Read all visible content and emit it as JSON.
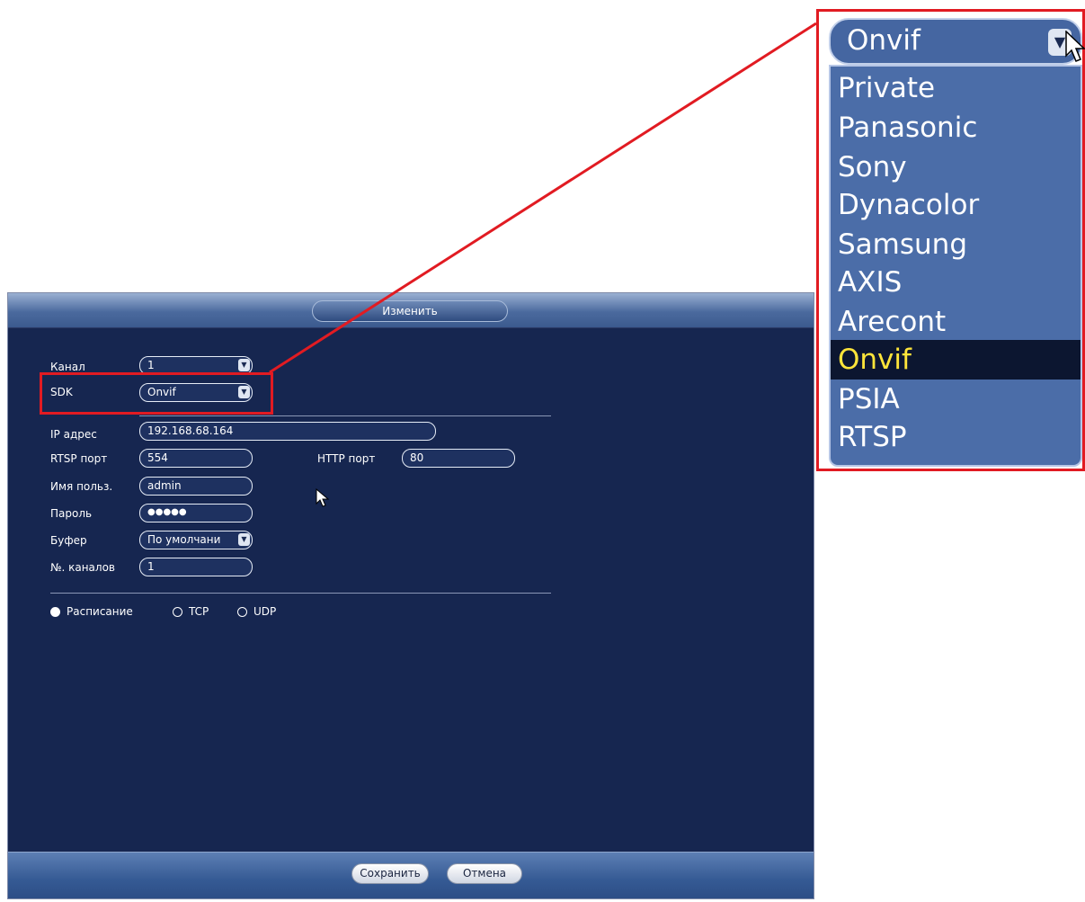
{
  "dialog": {
    "title": "Изменить",
    "channel_label": "Канал",
    "channel_value": "1",
    "sdk_label": "SDK",
    "sdk_value": "Onvif",
    "ip_label": "IP адрес",
    "ip_value": "192.168.68.164",
    "rtsp_label": "RTSP порт",
    "rtsp_value": "554",
    "http_label": "HTTP порт",
    "http_value": "80",
    "user_label": "Имя польз.",
    "user_value": "admin",
    "password_label": "Пароль",
    "password_value": "●●●●●",
    "buffer_label": "Буфер",
    "buffer_value": "По умолчани",
    "channels_label": "№. каналов",
    "channels_value": "1",
    "radios": [
      {
        "label": "Расписание",
        "selected": true
      },
      {
        "label": "TCP",
        "selected": false
      },
      {
        "label": "UDP",
        "selected": false
      }
    ],
    "save_label": "Сохранить",
    "cancel_label": "Отмена"
  },
  "dropdown": {
    "current": "Onvif",
    "options": [
      "Private",
      "Panasonic",
      "Sony",
      "Dynacolor",
      "Samsung",
      "AXIS",
      "Arecont",
      "Onvif",
      "PSIA",
      "RTSP"
    ],
    "selected_index": 7
  },
  "colors": {
    "highlight": "#e11b22",
    "selected_text": "#ffe53a",
    "dialog_bg": "#162650"
  }
}
